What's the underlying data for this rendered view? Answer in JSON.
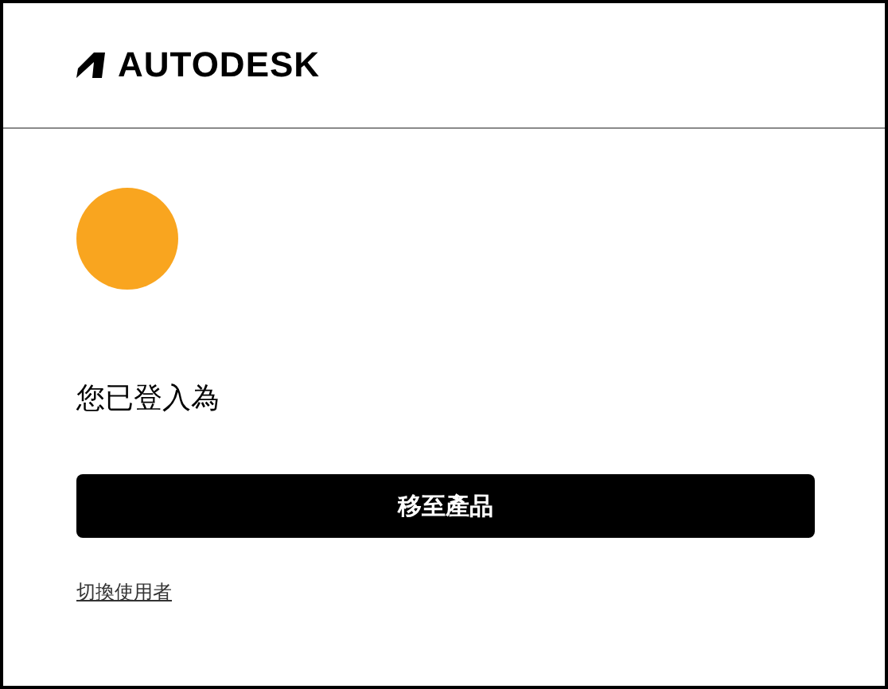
{
  "header": {
    "logo_text": "AUTODESK"
  },
  "body": {
    "message": "您已登入為",
    "primary_button": "移至產品",
    "switch_link": "切換使用者"
  }
}
